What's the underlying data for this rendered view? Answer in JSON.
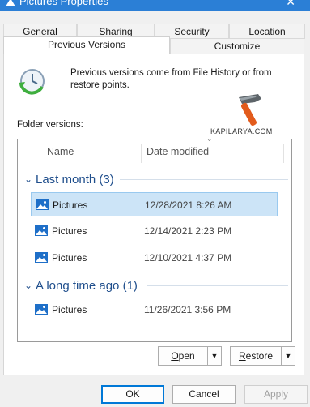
{
  "window": {
    "title": "Pictures Properties",
    "close_glyph": "✕"
  },
  "tabs_back": [
    "General",
    "Sharing",
    "Security",
    "Location"
  ],
  "tabs_front": [
    {
      "label": "Previous Versions",
      "active": true
    },
    {
      "label": "Customize",
      "active": false
    }
  ],
  "description": "Previous versions come from File History or from restore points.",
  "watermark": "KAPILARYA.COM",
  "folder_versions_label": "Folder versions:",
  "columns": {
    "name": "Name",
    "date": "Date modified"
  },
  "groups": [
    {
      "title": "Last month (3)",
      "items": [
        {
          "name": "Pictures",
          "date": "12/28/2021 8:26 AM",
          "selected": true
        },
        {
          "name": "Pictures",
          "date": "12/14/2021 2:23 PM",
          "selected": false
        },
        {
          "name": "Pictures",
          "date": "12/10/2021 4:37 PM",
          "selected": false
        }
      ]
    },
    {
      "title": "A long time ago (1)",
      "items": [
        {
          "name": "Pictures",
          "date": "11/26/2021 3:56 PM",
          "selected": false
        }
      ]
    }
  ],
  "split_buttons": {
    "open": {
      "first": "O",
      "rest": "pen"
    },
    "restore": {
      "first": "R",
      "rest": "estore"
    }
  },
  "buttons": {
    "ok": "OK",
    "cancel": "Cancel",
    "apply": "Apply"
  },
  "colors": {
    "accent": "#0078d7",
    "selection": "#cce4f7",
    "group_text": "#1f4e8c"
  },
  "icons": [
    "window-icon",
    "file-history-icon",
    "hammer-icon",
    "picture-icon",
    "chevron-down-icon",
    "sort-arrow-icon"
  ]
}
